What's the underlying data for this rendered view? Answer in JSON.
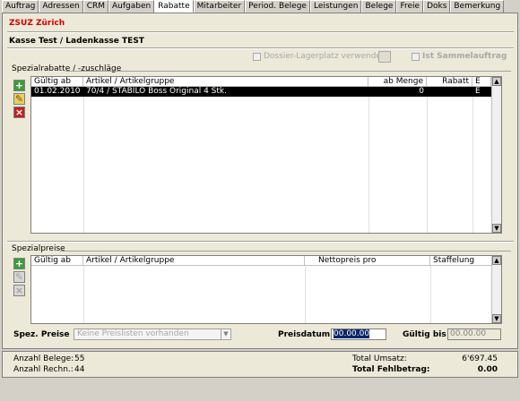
{
  "tabs": [
    "Auftrag",
    "Adressen",
    "CRM",
    "Aufgaben",
    "Rabatte",
    "Mitarbeiter",
    "Period. Belege",
    "Leistungen",
    "Belege",
    "Freie",
    "Doks",
    "Bemerkung"
  ],
  "active_tab": "Rabatte",
  "company": "ZSUZ Zürich",
  "kasse": "Kasse Test / Ladenkasse TEST",
  "options": {
    "dossier_label": "Dossier-Lagerplatz verwenden",
    "sammel_label": "Ist Sammelauftrag"
  },
  "spezialrabatte": {
    "title": "Spezialrabatte / -zuschläge",
    "columns": [
      "Gültig ab",
      "Artikel / Artikelgruppe",
      "ab Menge",
      "Rabatt",
      "E"
    ],
    "rows": [
      {
        "gueltig_ab": "01.02.2010",
        "artikel": "70/4 / STABILO Boss Original 4 Stk.",
        "ab_menge": "0",
        "rabatt": "",
        "e": "E"
      }
    ]
  },
  "spezialpreise": {
    "title": "Spezialpreise",
    "columns": [
      "Gültig ab",
      "Artikel / Artikelgruppe",
      "Nettopreis  pro",
      "Staffelung"
    ]
  },
  "spez_preise_label": "Spez. Preise",
  "spez_preise_select": "Keine Preislisten vorhanden",
  "preisdatum_label": "Preisdatum",
  "preisdatum_value": "00.00.00",
  "gueltig_bis_label": "Gültig  bis",
  "gueltig_bis_value": "00.00.00",
  "footer": {
    "anzahl_belege_label": "Anzahl Belege:",
    "anzahl_belege_value": "55",
    "anzahl_rechn_label": "Anzahl Rechn.:",
    "anzahl_rechn_value": "44",
    "total_umsatz_label": "Total Umsatz:",
    "total_umsatz_value": "6'697.45",
    "total_fehlbetrag_label": "Total Fehlbetrag:",
    "total_fehlbetrag_value": "0.00"
  },
  "colors": {
    "company": "#d00000",
    "selected_row": "#000000",
    "add_icon": "#3c9c3c",
    "delete_icon": "#c02020"
  }
}
